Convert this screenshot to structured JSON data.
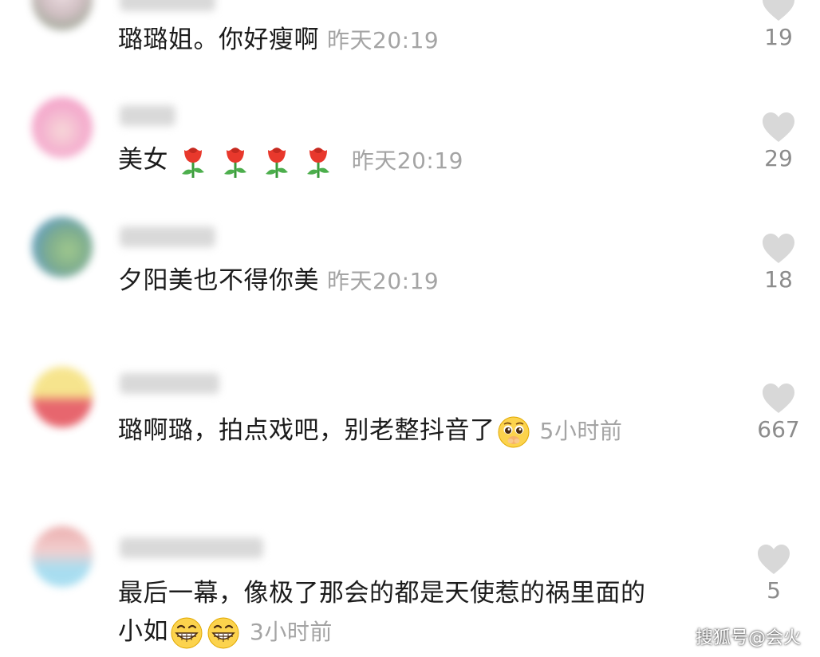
{
  "comments": [
    {
      "text": "璐璐姐。你好瘦啊",
      "time": "昨天20:19",
      "likes": "19",
      "avatar_colors": [
        "#e9d7dc",
        "#6f8a6a"
      ]
    },
    {
      "text": "美女",
      "emoji": "rose-emoji",
      "emoji_count": 4,
      "time": "昨天20:19",
      "likes": "29",
      "avatar_colors": [
        "#f07fb5",
        "#f3c3c8"
      ]
    },
    {
      "text": "夕阳美也不得你美",
      "time": "昨天20:19",
      "likes": "18",
      "avatar_colors": [
        "#2f7fd8",
        "#6aa07a"
      ]
    },
    {
      "text": "璐啊璐，拍点戏吧，别老整抖音了",
      "emoji": "pleading-face-emoji",
      "time": "5小时前",
      "likes": "667",
      "avatar_colors": [
        "#f5e07a",
        "#e34c55"
      ]
    },
    {
      "text_line1": "最后一幕，像极了那会的都是天使惹的祸里面的",
      "text_line2": "小如",
      "emoji": "grinning-face-emoji",
      "emoji_count": 2,
      "time": "3小时前",
      "likes": "5",
      "avatar_colors": [
        "#e8a0a0",
        "#9ad8ee"
      ]
    }
  ],
  "watermark": "搜狐号@会火"
}
